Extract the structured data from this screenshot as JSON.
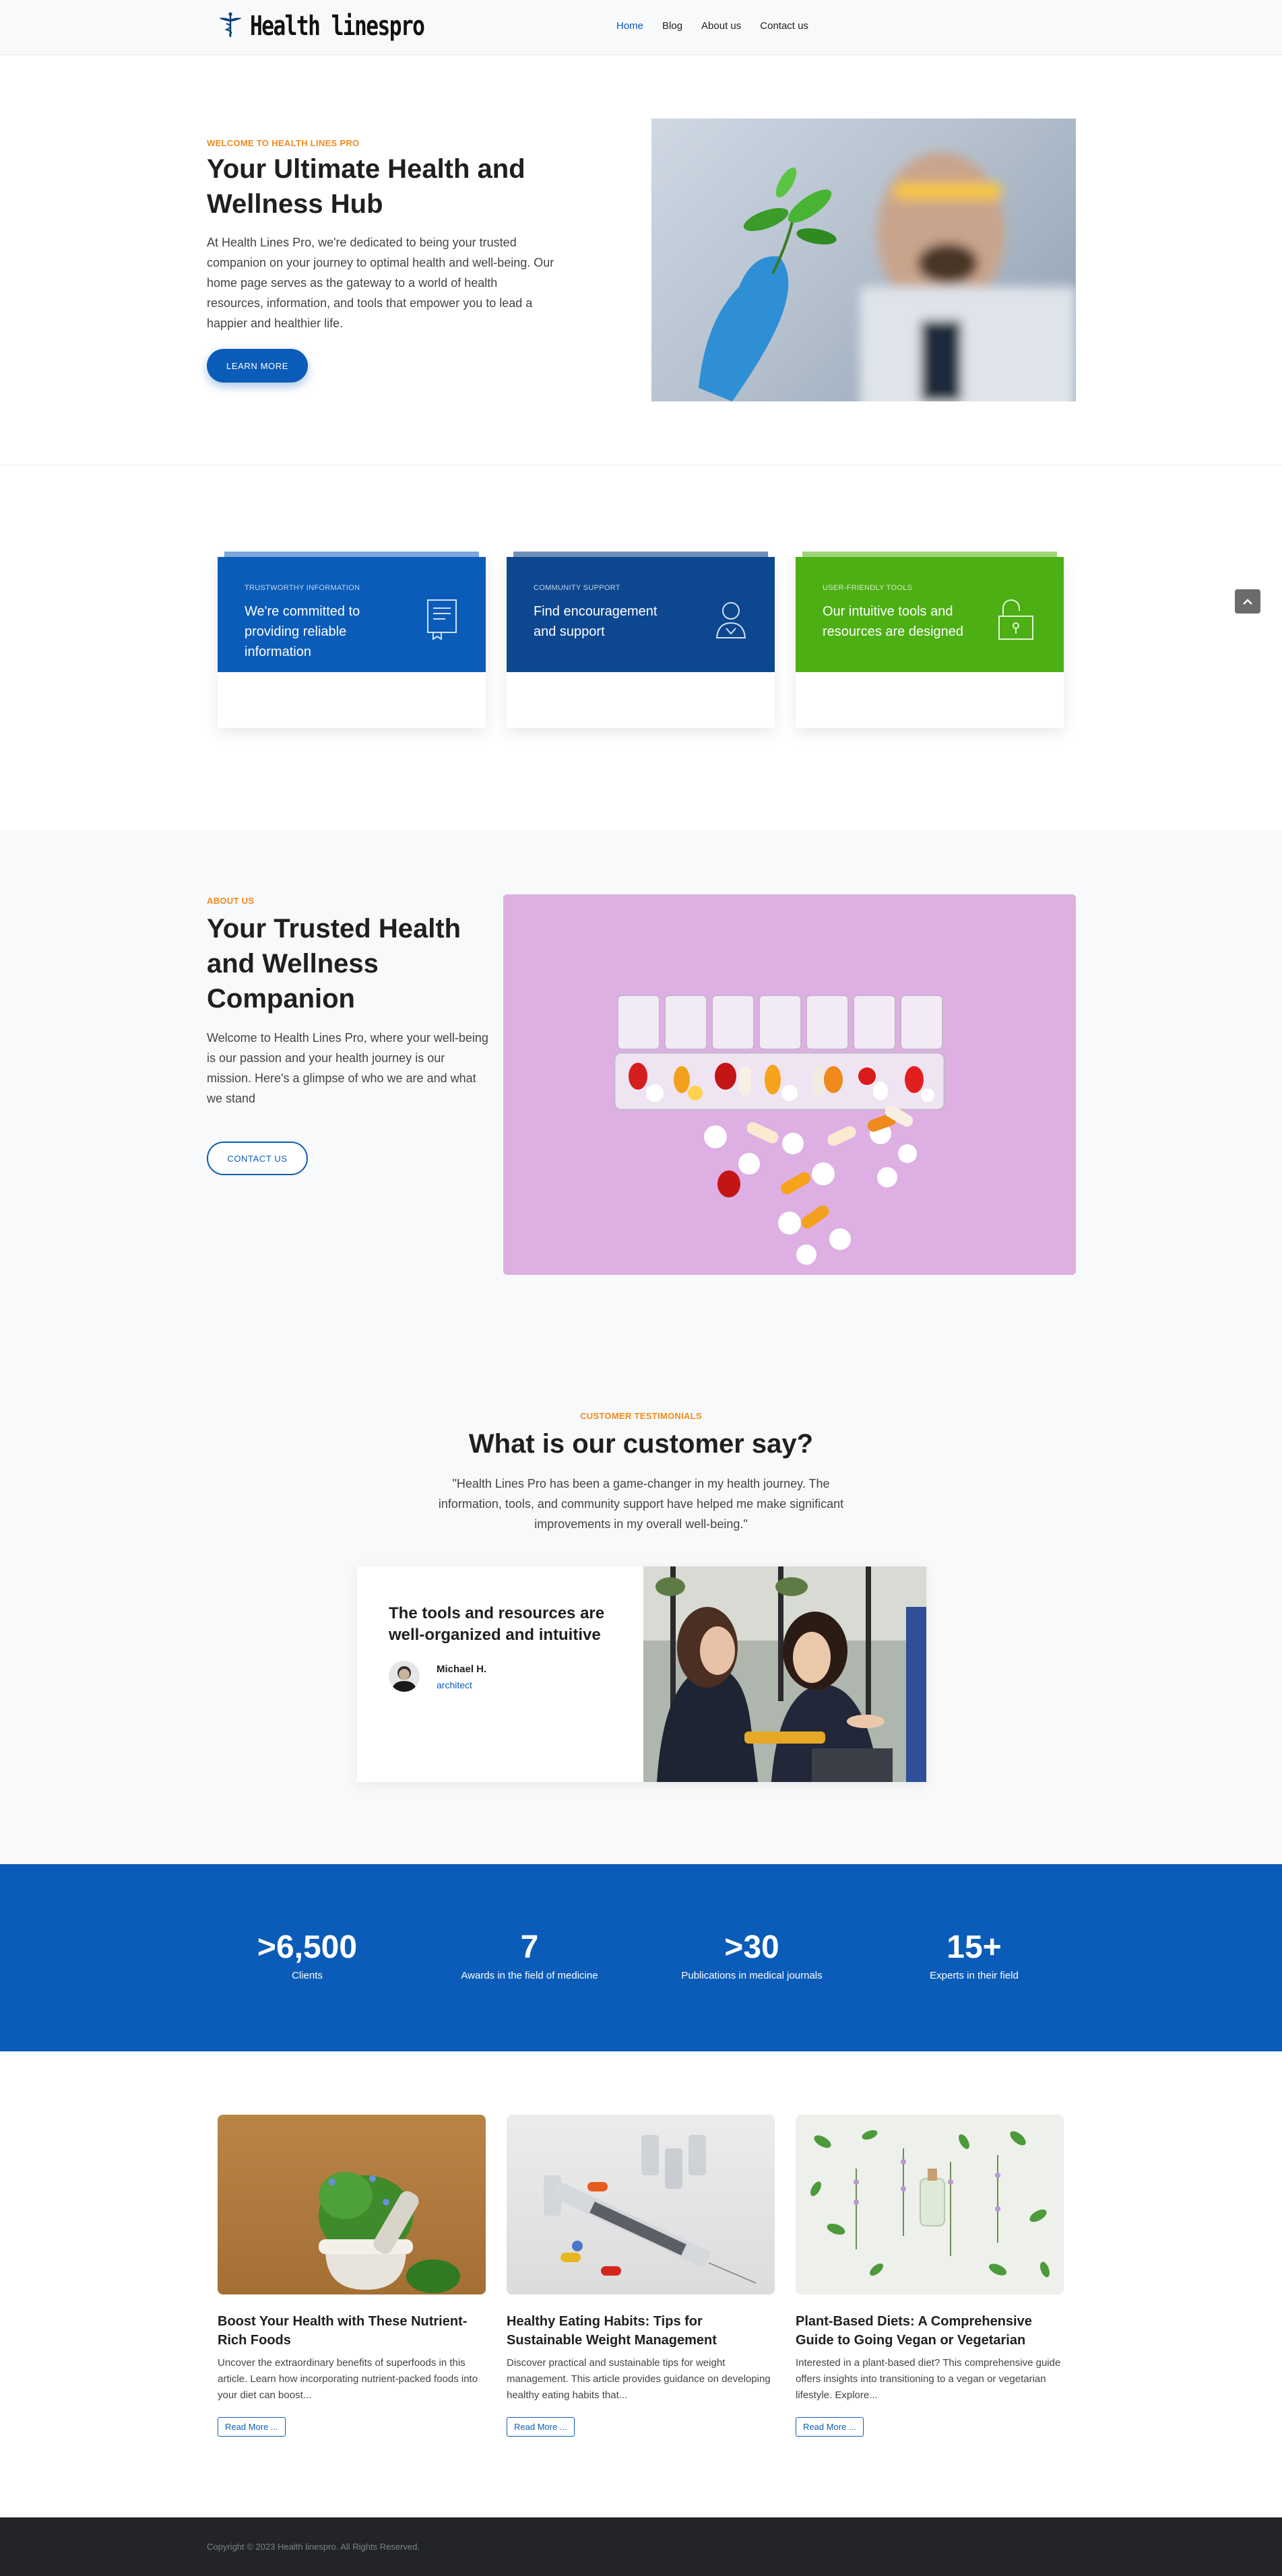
{
  "brand": {
    "name": "Health linespro"
  },
  "nav": {
    "items": [
      "Home",
      "Blog",
      "About us",
      "Contact us"
    ]
  },
  "hero": {
    "eyebrow": "WELCOME TO HEALTH LINES PRO",
    "title": "Your Ultimate Health and Wellness Hub",
    "text": "At Health Lines Pro, we're dedicated to being your trusted companion on your journey to optimal health and well-being. Our home page serves as the gateway to a world of health resources, information, and tools that empower you to lead a happier and healthier life.",
    "button": "LEARN MORE"
  },
  "features": [
    {
      "tag": "TRUSTWORTHY INFORMATION",
      "title": "We're committed to providing reliable information",
      "icon": "document-icon",
      "color": "#0b5cb8"
    },
    {
      "tag": "COMMUNITY SUPPORT",
      "title": "Find encouragement and support",
      "icon": "person-icon",
      "color": "#0d4790"
    },
    {
      "tag": "USER-FRIENDLY TOOLS",
      "title": "Our intuitive tools and resources are designed",
      "icon": "unlock-icon",
      "color": "#4caf14"
    }
  ],
  "about": {
    "eyebrow": "ABOUT US",
    "title": "Your Trusted Health and Wellness Companion",
    "text": "Welcome to Health Lines Pro, where your well-being is our passion and your health journey is our mission. Here's a glimpse of who we are and what we stand",
    "button": "CONTACT US"
  },
  "testimonials": {
    "eyebrow": "CUSTOMER TESTIMONIALS",
    "title": "What is our customer say?",
    "quote": "\"Health Lines Pro has been a game-changer in my health journey. The information, tools, and community support have helped me make significant improvements in my overall well-being.\"",
    "card_title": "The tools and resources are well-organized and intuitive",
    "author": "Michael H.",
    "role": "architect"
  },
  "stats": [
    {
      "num": ">6,500",
      "label": "Clients"
    },
    {
      "num": "7",
      "label": "Awards in the field of medicine"
    },
    {
      "num": ">30",
      "label": "Publications in medical journals"
    },
    {
      "num": "15+",
      "label": "Experts in their field"
    }
  ],
  "blog": [
    {
      "title": "Boost Your Health with These Nutrient-Rich Foods",
      "desc": "Uncover the extraordinary benefits of superfoods in this article. Learn how incorporating nutrient-packed foods into your diet can boost...",
      "button": "Read More ..."
    },
    {
      "title": "Healthy Eating Habits: Tips for Sustainable Weight Management",
      "desc": "Discover practical and sustainable tips for weight management. This article provides guidance on developing healthy eating habits that...",
      "button": "Read More ..."
    },
    {
      "title": "Plant-Based Diets: A Comprehensive Guide to Going Vegan or Vegetarian",
      "desc": "Interested in a plant-based diet? This comprehensive guide offers insights into transitioning to a vegan or vegetarian lifestyle. Explore...",
      "button": "Read More ..."
    }
  ],
  "footer": {
    "copyright": "Copyright © 2023 Health linespro. All Rights Reserved."
  },
  "colors": {
    "primary": "#0b5cb8",
    "accent": "#f08a1c",
    "green": "#4caf14",
    "dark": "#222428"
  }
}
